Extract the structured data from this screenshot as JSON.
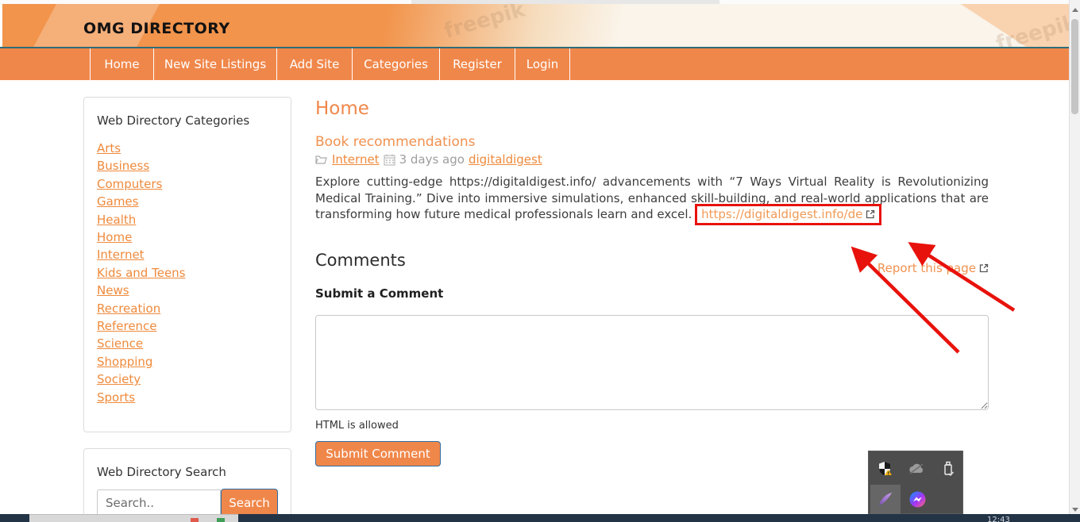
{
  "header": {
    "site_title": "OMG DIRECTORY",
    "watermark": "freepik"
  },
  "nav": {
    "items": [
      "Home",
      "New Site Listings",
      "Add Site",
      "Categories",
      "Register",
      "Login"
    ]
  },
  "sidebar": {
    "categories_title": "Web Directory Categories",
    "categories": [
      "Arts",
      "Business",
      "Computers",
      "Games",
      "Health",
      "Home",
      "Internet",
      "Kids and Teens",
      "News",
      "Recreation",
      "Reference",
      "Science",
      "Shopping",
      "Society",
      "Sports"
    ],
    "search_title": "Web Directory Search",
    "search": {
      "placeholder": "Search..",
      "button_label": "Search"
    }
  },
  "main": {
    "page_heading": "Home",
    "post": {
      "title": "Book recommendations",
      "category": "Internet",
      "posted": "3 days ago",
      "author": "digitaldigest",
      "body": "Explore cutting-edge https://digitaldigest.info/ advancements with “7 Ways Virtual Reality is Revolutionizing Medical Training.” Dive into immersive simulations, enhanced skill-building, and real-world applications that are transforming how future medical professionals learn and excel.",
      "highlighted_link": "https://digitaldigest.info/de"
    },
    "comments": {
      "heading": "Comments",
      "report_link": "Report this page",
      "form_heading": "Submit a Comment",
      "note": "HTML is allowed",
      "submit_label": "Submit Comment"
    }
  },
  "taskbar": {
    "clock": "12:43"
  },
  "annotations": {
    "highlight_color": "#e8120c",
    "arrow_count": 2
  },
  "tray": {
    "icons": [
      "defender-alert",
      "cloud-offline",
      "usb-safely-remove",
      "feather-pen",
      "messenger"
    ]
  },
  "colors": {
    "accent": "#f0874a",
    "link": "#ef8a3c",
    "nav_line": "#2f6d78",
    "taskbar": "#243447"
  }
}
